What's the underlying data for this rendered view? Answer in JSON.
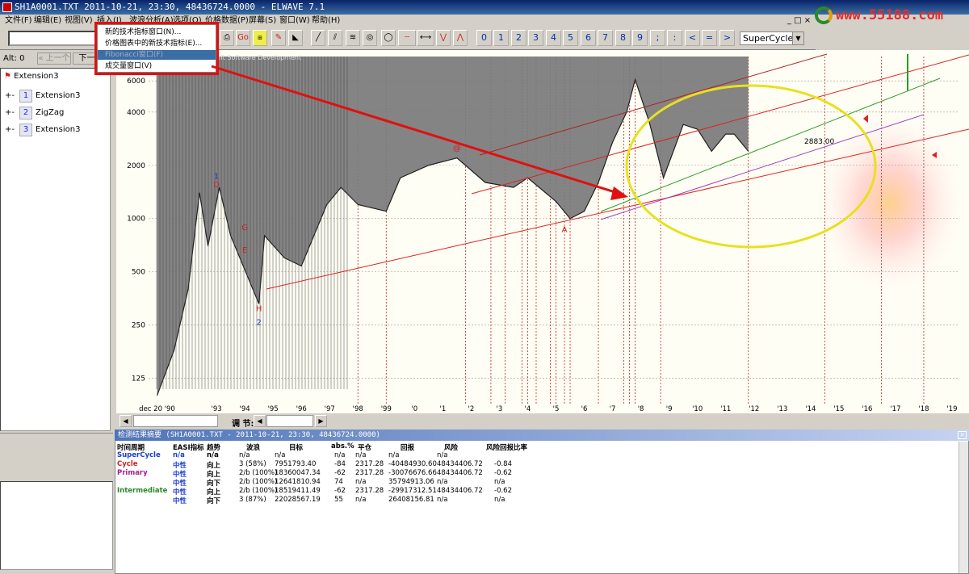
{
  "title": "SH1A0001.TXT  2011-10-21, 23:30, 48436724.0000 - ELWAVE 7.1",
  "menu": [
    "文件(F)",
    "编辑(E)",
    "视图(V)",
    "插入(I)",
    "波浪分析(A)",
    "选项(O)",
    "价格数据(P)",
    "屏幕(S)",
    "窗口(W)",
    "帮助(H)"
  ],
  "window_buttons": "_ □ ×",
  "logo": "www.55188.com",
  "toolbar": {
    "numbers": [
      "0",
      "1",
      "2",
      "3",
      "4",
      "5",
      "6",
      "7",
      "8",
      "9",
      ";",
      ":",
      "<",
      "=",
      ">"
    ],
    "select_value": "SuperCycle"
  },
  "dropdown": {
    "items": [
      "新的技术指标窗口(N)...",
      "价格图表中的新技术指标(E)...",
      "Fibonacci窗口(F)",
      "成交量窗口(V)"
    ],
    "highlight_index": 2
  },
  "left": {
    "alt_label": "Alt: 0",
    "prev": "上一个",
    "next": "下一",
    "root": "Extension3",
    "items": [
      {
        "num": "1",
        "label": "Extension3"
      },
      {
        "num": "2",
        "label": "ZigZag"
      },
      {
        "num": "3",
        "label": "Extension3"
      }
    ]
  },
  "chart_data": {
    "type": "line",
    "price_axis_labels": [
      "6000",
      "4000",
      "2000",
      "1000",
      "500",
      "250",
      "125"
    ],
    "price_axis_values": [
      6000,
      4000,
      2000,
      1000,
      500,
      250,
      125
    ],
    "x_labels": [
      "dec 20 '90",
      "'93",
      "'94",
      "'95",
      "'96",
      "'97",
      "'98",
      "'99",
      "'0",
      "'1",
      "'2",
      "'3",
      "'4",
      "'5",
      "'6",
      "'7",
      "'8",
      "'9",
      "'10",
      "'11",
      "'12",
      "'13",
      "'14",
      "'15",
      "'16",
      "'17",
      "'18",
      "'19"
    ],
    "last_price_label": "2883.00",
    "overlay_text": "soft Software Development",
    "wave_labels": [
      {
        "text": "1",
        "color": "#1c3ccc"
      },
      {
        "text": "D",
        "color": "#cc2222"
      },
      {
        "text": "G",
        "color": "#cc2222"
      },
      {
        "text": "E",
        "color": "#cc2222"
      },
      {
        "text": "H",
        "color": "#cc2222"
      },
      {
        "text": "2",
        "color": "#1c3ccc"
      },
      {
        "text": "A",
        "color": "#cc2222"
      },
      {
        "text": "@",
        "color": "#cc2222"
      }
    ],
    "price_series": [
      {
        "year": 1990.9,
        "price": 100
      },
      {
        "year": 1991.5,
        "price": 180
      },
      {
        "year": 1992.0,
        "price": 400
      },
      {
        "year": 1992.4,
        "price": 1400
      },
      {
        "year": 1992.7,
        "price": 700
      },
      {
        "year": 1993.1,
        "price": 1500
      },
      {
        "year": 1993.5,
        "price": 800
      },
      {
        "year": 1994.5,
        "price": 330
      },
      {
        "year": 1994.7,
        "price": 800
      },
      {
        "year": 1995.4,
        "price": 600
      },
      {
        "year": 1996.0,
        "price": 540
      },
      {
        "year": 1996.9,
        "price": 1200
      },
      {
        "year": 1997.4,
        "price": 1500
      },
      {
        "year": 1998.0,
        "price": 1200
      },
      {
        "year": 1999.0,
        "price": 1100
      },
      {
        "year": 1999.5,
        "price": 1700
      },
      {
        "year": 2000.5,
        "price": 2000
      },
      {
        "year": 2001.5,
        "price": 2200
      },
      {
        "year": 2002.5,
        "price": 1600
      },
      {
        "year": 2003.5,
        "price": 1500
      },
      {
        "year": 2004.0,
        "price": 1700
      },
      {
        "year": 2005.0,
        "price": 1250
      },
      {
        "year": 2005.5,
        "price": 1000
      },
      {
        "year": 2006.0,
        "price": 1100
      },
      {
        "year": 2006.5,
        "price": 1600
      },
      {
        "year": 2007.0,
        "price": 2700
      },
      {
        "year": 2007.5,
        "price": 4000
      },
      {
        "year": 2007.8,
        "price": 6100
      },
      {
        "year": 2008.3,
        "price": 3500
      },
      {
        "year": 2008.8,
        "price": 1700
      },
      {
        "year": 2009.5,
        "price": 3400
      },
      {
        "year": 2010.0,
        "price": 3200
      },
      {
        "year": 2010.5,
        "price": 2400
      },
      {
        "year": 2011.0,
        "price": 3000
      },
      {
        "year": 2011.3,
        "price": 3000
      },
      {
        "year": 2011.8,
        "price": 2400
      }
    ]
  },
  "scroll": {
    "adjust_label": "调 节:"
  },
  "panel": {
    "title": "检测结果摘要 (SH1A0001.TXT - 2011-10-21, 23:30, 48436724.0000)",
    "headers": [
      "时间周期",
      "EASI指标",
      "趋势",
      "波浪",
      "目标",
      "abs.%",
      "平仓",
      "回报",
      "风险",
      "风险回报比率"
    ],
    "rows": [
      {
        "period": "SuperCycle",
        "period_color": "#1c3ccc",
        "easi": "n/a",
        "trend": "n/a",
        "wave": "n/a",
        "target": "n/a",
        "abs": "n/a",
        "close": "n/a",
        "ret": "n/a",
        "risk": "n/a",
        "ratio": ""
      },
      {
        "period": "Cycle",
        "period_color": "#cc2222",
        "easi": "中性",
        "trend": "向上",
        "wave": "3 (58%)",
        "target": "7951793.40",
        "abs": "-84",
        "close": "2317.28",
        "ret": "-40484930.60",
        "risk": "48434406.72",
        "ratio": "-0.84"
      },
      {
        "period": "Primary",
        "period_color": "#a02090",
        "easi": "中性",
        "trend": "向上",
        "wave": "2/b (100%)",
        "target": "18360047.34",
        "abs": "-62",
        "close": "2317.28",
        "ret": "-30076676.66",
        "risk": "48434406.72",
        "ratio": "-0.62"
      },
      {
        "period": "",
        "period_color": "#000",
        "easi": "中性",
        "trend": "向下",
        "wave": "2/b (100%)",
        "target": "12641810.94",
        "abs": "74",
        "close": "n/a",
        "ret": "35794913.06",
        "risk": "n/a",
        "ratio": "n/a"
      },
      {
        "period": "Intermediate",
        "period_color": "#2a8a2a",
        "easi": "中性",
        "trend": "向上",
        "wave": "2/b (100%)",
        "target": "18519411.49",
        "abs": "-62",
        "close": "2317.28",
        "ret": "-29917312.51",
        "risk": "48434406.72",
        "ratio": "-0.62"
      },
      {
        "period": "",
        "period_color": "#000",
        "easi": "中性",
        "trend": "向下",
        "wave": "3 (87%)",
        "target": "22028567.19",
        "abs": "55",
        "close": "n/a",
        "ret": "26408156.81",
        "risk": "n/a",
        "ratio": "n/a"
      }
    ]
  }
}
